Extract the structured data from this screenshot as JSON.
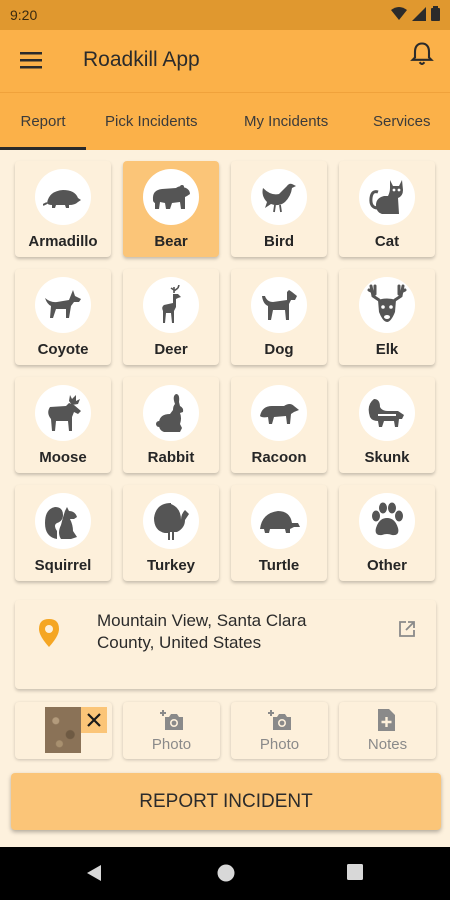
{
  "status": {
    "time": "9:20"
  },
  "appbar": {
    "title": "Roadkill App",
    "menu_icon": "menu-icon",
    "bell_icon": "bell-icon"
  },
  "tabs": [
    {
      "label": "Report",
      "active": true
    },
    {
      "label": "Pick Incidents"
    },
    {
      "label": "My Incidents"
    },
    {
      "label": "Services"
    }
  ],
  "animals": [
    {
      "label": "Armadillo",
      "icon": "armadillo-icon"
    },
    {
      "label": "Bear",
      "icon": "bear-icon",
      "selected": true
    },
    {
      "label": "Bird",
      "icon": "bird-icon"
    },
    {
      "label": "Cat",
      "icon": "cat-icon"
    },
    {
      "label": "Coyote",
      "icon": "coyote-icon"
    },
    {
      "label": "Deer",
      "icon": "deer-icon"
    },
    {
      "label": "Dog",
      "icon": "dog-icon"
    },
    {
      "label": "Elk",
      "icon": "elk-icon"
    },
    {
      "label": "Moose",
      "icon": "moose-icon"
    },
    {
      "label": "Rabbit",
      "icon": "rabbit-icon"
    },
    {
      "label": "Racoon",
      "icon": "racoon-icon"
    },
    {
      "label": "Skunk",
      "icon": "skunk-icon"
    },
    {
      "label": "Squirrel",
      "icon": "squirrel-icon"
    },
    {
      "label": "Turkey",
      "icon": "turkey-icon"
    },
    {
      "label": "Turtle",
      "icon": "turtle-icon"
    },
    {
      "label": "Other",
      "icon": "paw-icon"
    }
  ],
  "location": {
    "line1": "Mountain View, Santa Clara",
    "line2": "County, United States"
  },
  "attachments": {
    "photo1_label": "Photo",
    "photo2_label": "Photo",
    "notes_label": "Notes"
  },
  "report_button": "REPORT INCIDENT",
  "colors": {
    "accent": "#fbb149",
    "card": "#fdf0db",
    "selected": "#fbc578",
    "icon": "#555555",
    "pin": "#f5a623"
  }
}
